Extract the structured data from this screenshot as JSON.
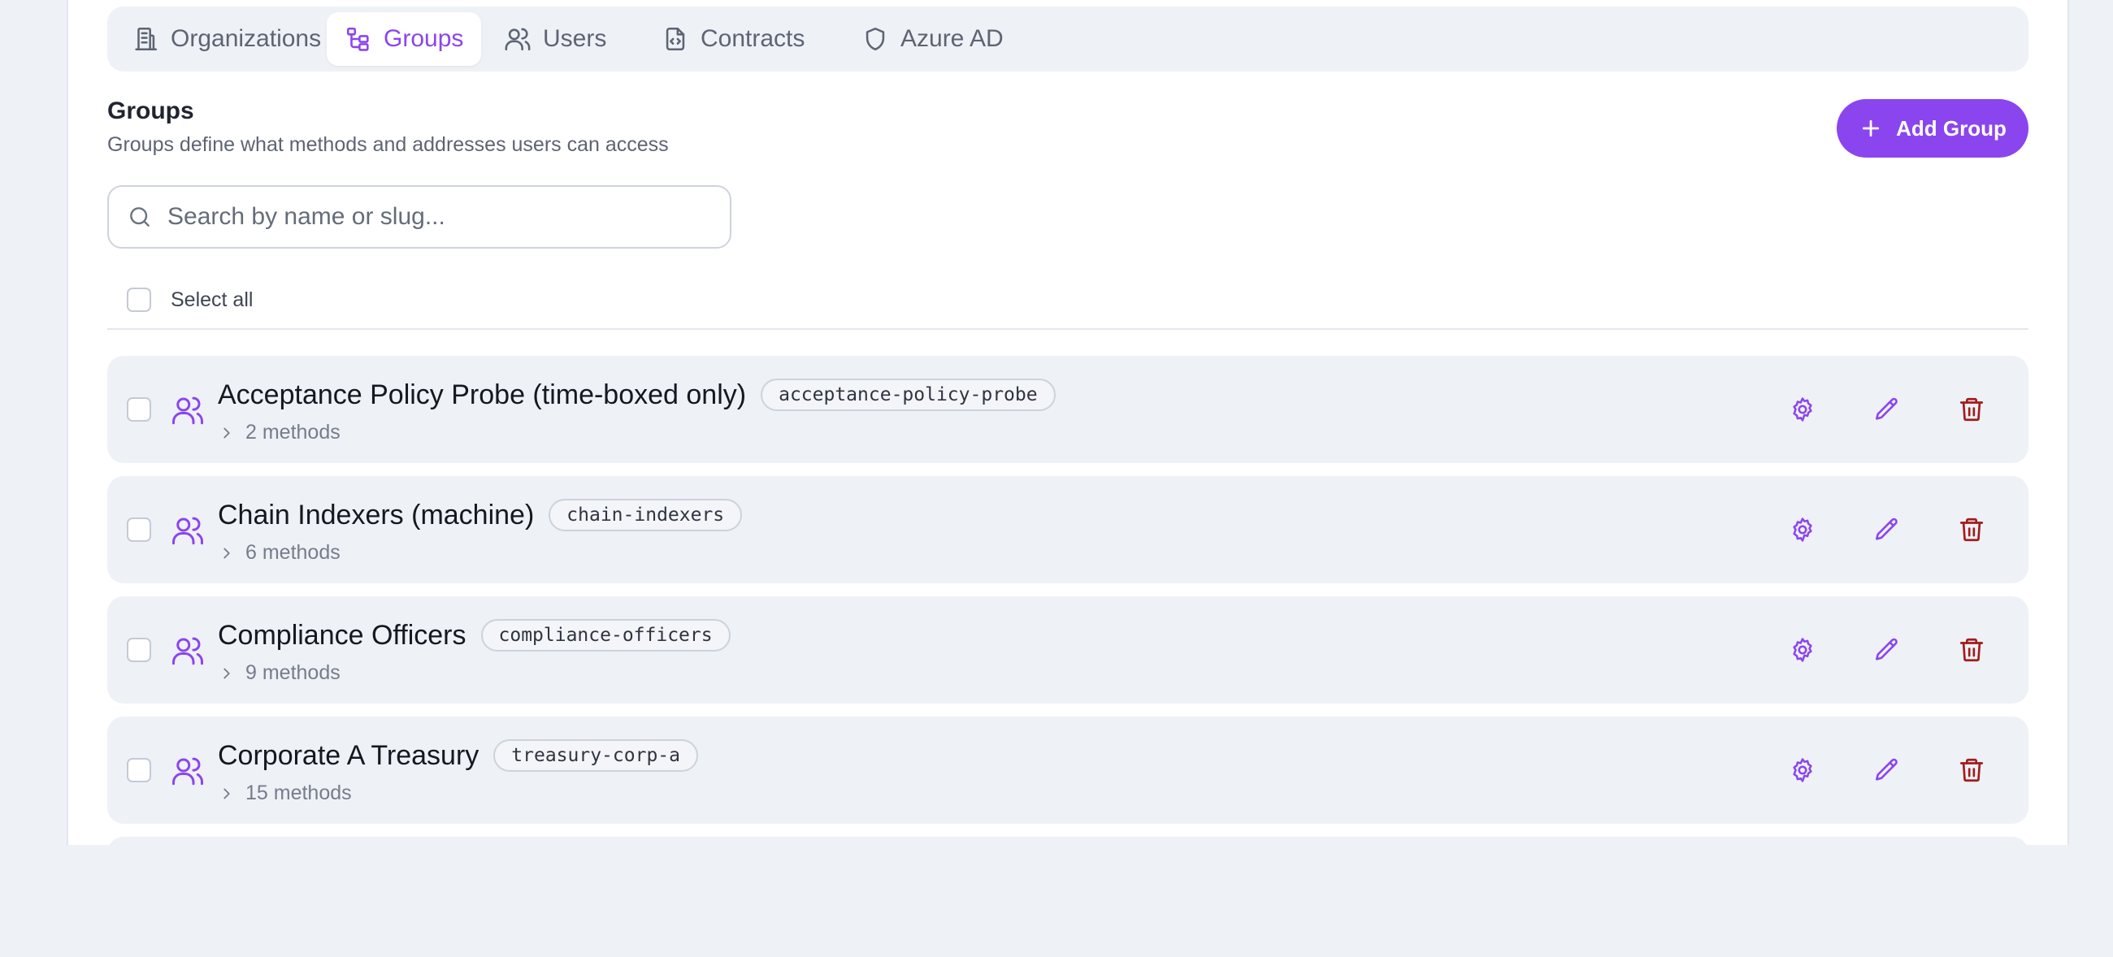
{
  "tabs": [
    {
      "label": "Organizations",
      "icon": "building-icon",
      "active": false
    },
    {
      "label": "Groups",
      "icon": "hierarchy-icon",
      "active": true
    },
    {
      "label": "Users",
      "icon": "users-icon",
      "active": false
    },
    {
      "label": "Contracts",
      "icon": "file-code-icon",
      "active": false
    },
    {
      "label": "Azure AD",
      "icon": "shield-icon",
      "active": false
    }
  ],
  "section": {
    "title": "Groups",
    "description": "Groups define what methods and addresses users can access"
  },
  "add_button": {
    "label": "Add Group",
    "icon": "plus-icon"
  },
  "search": {
    "placeholder": "Search by name or slug...",
    "value": "",
    "icon": "search-icon"
  },
  "select_all": {
    "label": "Select all"
  },
  "groups": [
    {
      "name": "Acceptance Policy Probe (time-boxed only)",
      "slug": "acceptance-policy-probe",
      "methods": "2 methods"
    },
    {
      "name": "Chain Indexers (machine)",
      "slug": "chain-indexers",
      "methods": "6 methods"
    },
    {
      "name": "Compliance Officers",
      "slug": "compliance-officers",
      "methods": "9 methods"
    },
    {
      "name": "Corporate A Treasury",
      "slug": "treasury-corp-a",
      "methods": "15 methods"
    }
  ],
  "colors": {
    "accent": "#8b45ee",
    "danger": "#a11d1d",
    "row_bg": "#eef1f6",
    "page_bg": "#eef1f6"
  }
}
